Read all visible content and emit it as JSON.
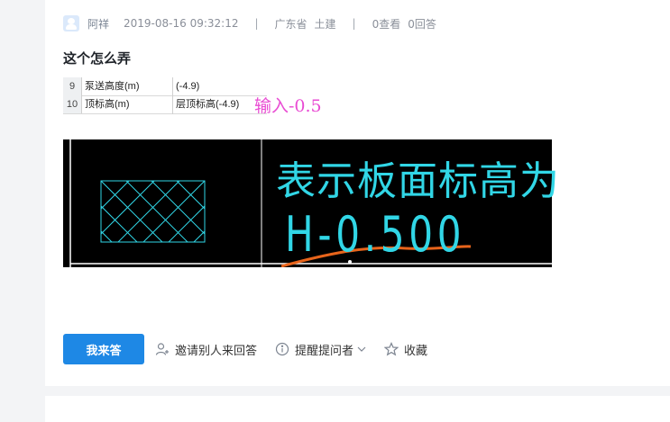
{
  "post": {
    "author": "阿祥",
    "time": "2019-08-16 09:32:12",
    "separator": "|",
    "region": "广东省",
    "category": "土建",
    "views": "0查看",
    "answers": "0回答",
    "title": "这个怎么弄"
  },
  "table": {
    "rows": [
      {
        "num": "9",
        "name": "泵送高度(m)",
        "value": "(-4.9)"
      },
      {
        "num": "10",
        "name": "顶标高(m)",
        "value": "层顶标高(-4.9)"
      }
    ],
    "note": "输入-0.5"
  },
  "drawing": {
    "line1": "表示板面标高为",
    "line2": "H-0.500",
    "text_color": "#31d6e6",
    "stroke_color": "#e8641b"
  },
  "actions": {
    "answer_label": "我来答",
    "invite_label": "邀请别人来回答",
    "remind_label": "提醒提问者",
    "favorite_label": "收藏",
    "primary_color": "#1e88e5"
  },
  "icons": {
    "avatar": "user-avatar-icon",
    "invite": "add-user-icon",
    "remind": "info-circle-icon",
    "dropdown": "chevron-down-icon",
    "favorite": "star-icon"
  }
}
